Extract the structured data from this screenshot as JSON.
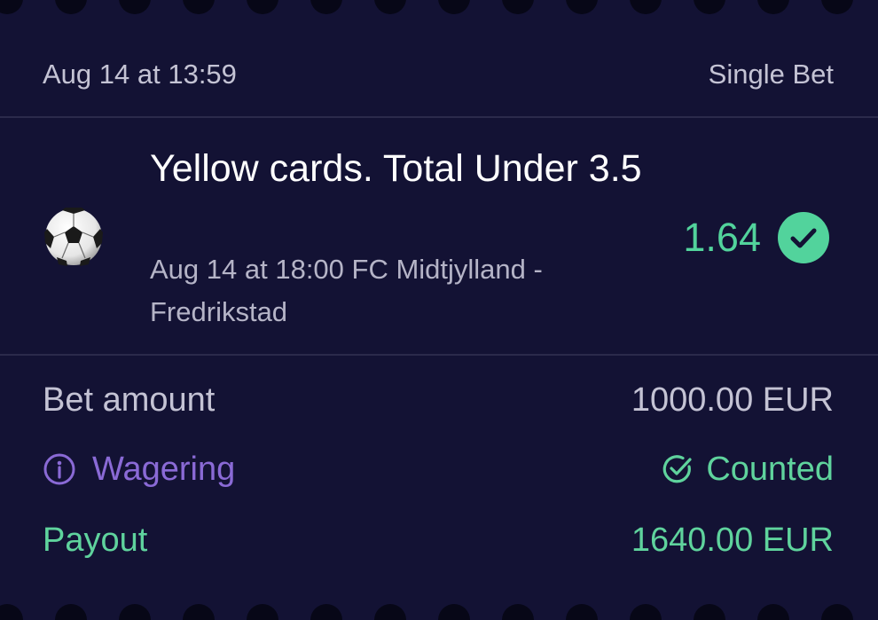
{
  "bet": {
    "placed_at": "Aug 14 at 13:59",
    "type": "Single Bet"
  },
  "selection": {
    "sport_icon": "soccer-ball-icon",
    "market": "Yellow cards. Total Under 3.5",
    "event": "Aug 14 at 18:00 FC Midtjylland - Fredrikstad",
    "odds": "1.64",
    "status_icon": "check-circle-icon"
  },
  "summary": {
    "bet_amount_label": "Bet amount",
    "bet_amount_value": "1000.00 EUR",
    "wagering_label": "Wagering",
    "wagering_icon": "info-icon",
    "wagering_value": "Counted",
    "wagering_value_icon": "check-circle-outline-icon",
    "payout_label": "Payout",
    "payout_value": "1640.00 EUR"
  },
  "colors": {
    "background": "#131234",
    "accent_green": "#52d39c",
    "wagering_purple": "#8a6ad6",
    "text_primary": "#ffffff",
    "text_secondary": "#c4c3d4"
  }
}
